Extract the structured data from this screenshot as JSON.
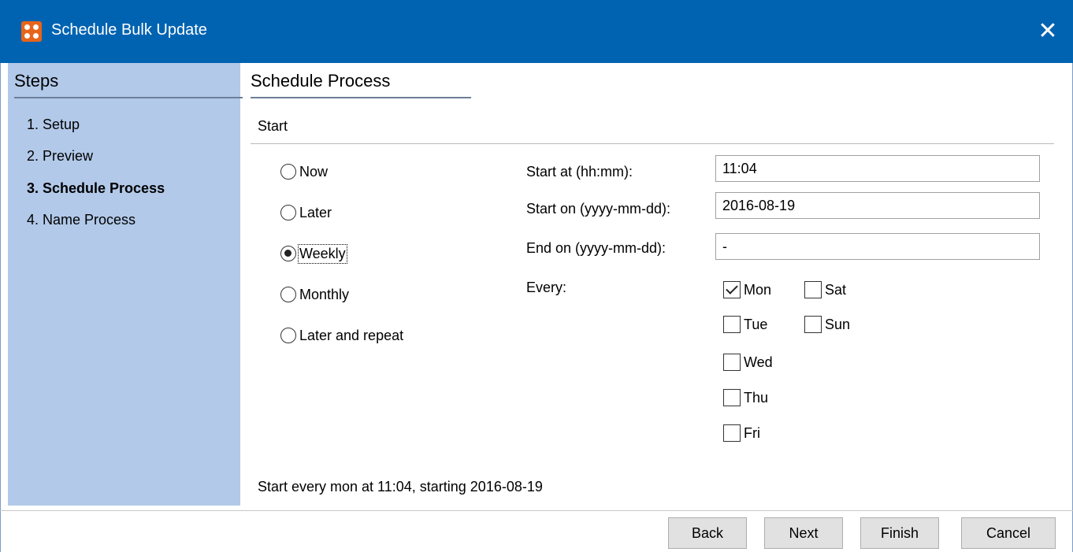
{
  "window": {
    "title": "Schedule Bulk Update",
    "close_glyph": "✕",
    "app_icon": "app-grid-icon"
  },
  "steps": {
    "title": "Steps",
    "items": [
      {
        "label": "1. Setup",
        "active": false
      },
      {
        "label": "2. Preview",
        "active": false
      },
      {
        "label": "3. Schedule Process",
        "active": true
      },
      {
        "label": "4. Name Process",
        "active": false
      }
    ]
  },
  "main": {
    "title": "Schedule Process",
    "section": "Start",
    "options": [
      {
        "label": "Now",
        "selected": false
      },
      {
        "label": "Later",
        "selected": false
      },
      {
        "label": "Weekly",
        "selected": true
      },
      {
        "label": "Monthly",
        "selected": false
      },
      {
        "label": "Later and repeat",
        "selected": false
      }
    ],
    "fields": {
      "start_at": {
        "label": "Start at (hh:mm):",
        "value": "11:04"
      },
      "start_on": {
        "label": "Start on (yyyy-mm-dd):",
        "value": "2016-08-19"
      },
      "end_on": {
        "label": "End on (yyyy-mm-dd):",
        "value": "-"
      }
    },
    "every_label": "Every:",
    "days": [
      {
        "label": "Mon",
        "checked": true
      },
      {
        "label": "Tue",
        "checked": false
      },
      {
        "label": "Wed",
        "checked": false
      },
      {
        "label": "Thu",
        "checked": false
      },
      {
        "label": "Fri",
        "checked": false
      },
      {
        "label": "Sat",
        "checked": false
      },
      {
        "label": "Sun",
        "checked": false
      }
    ],
    "summary": "Start every mon at 11:04, starting 2016-08-19"
  },
  "buttons": {
    "back": "Back",
    "next": "Next",
    "finish": "Finish",
    "cancel": "Cancel"
  },
  "colors": {
    "titlebar": "#0063b1",
    "sidebar": "#b2c9e9",
    "icon": "#e8641b"
  }
}
